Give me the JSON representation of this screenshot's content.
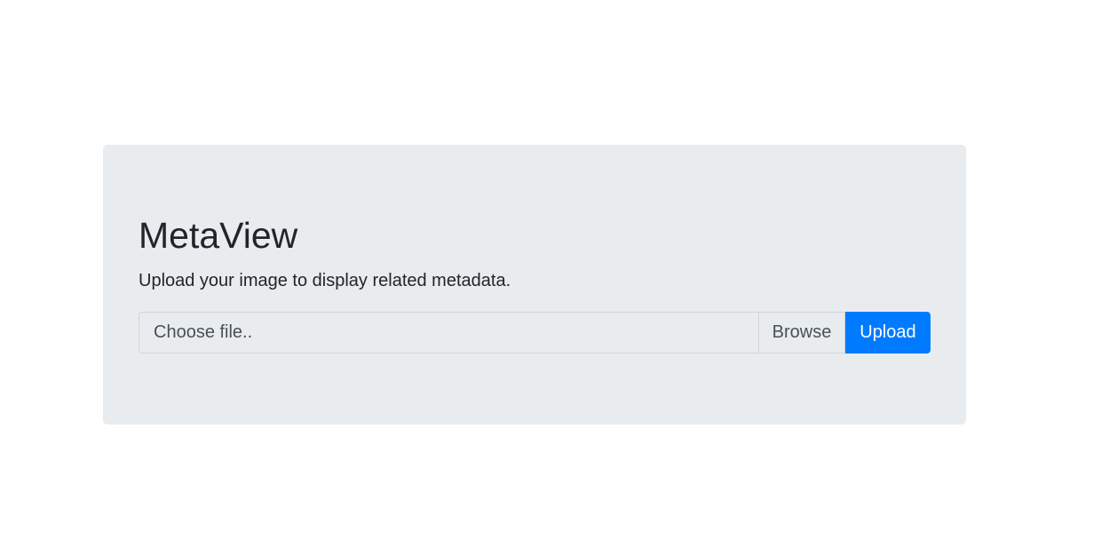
{
  "app": {
    "title": "MetaView",
    "description": "Upload your image to display related metadata."
  },
  "upload": {
    "file_placeholder": "Choose file..",
    "browse_label": "Browse",
    "upload_label": "Upload"
  },
  "colors": {
    "jumbotron_bg": "#e9ecef",
    "primary": "#007bff",
    "text": "#212529",
    "input_text": "#495057",
    "border": "#ced4da"
  }
}
